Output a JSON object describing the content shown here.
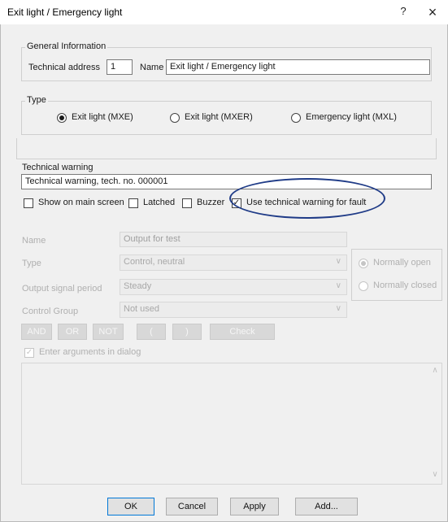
{
  "window": {
    "title": "Exit light / Emergency light",
    "help": "?",
    "close": "×"
  },
  "general": {
    "legend": "General Information",
    "tech_address_label": "Technical address",
    "tech_address_value": "1",
    "name_label": "Name",
    "name_value": "Exit light / Emergency light"
  },
  "type": {
    "legend": "Type",
    "options": [
      {
        "label": "Exit light (MXE)",
        "selected": true
      },
      {
        "label": "Exit light (MXER)",
        "selected": false
      },
      {
        "label": "Emergency light (MXL)",
        "selected": false
      }
    ]
  },
  "warning": {
    "legend": "Technical warning",
    "value": "Technical warning, tech. no. 000001",
    "checkboxes": [
      {
        "label": "Show on main screen",
        "checked": false
      },
      {
        "label": "Latched",
        "checked": false
      },
      {
        "label": "Buzzer",
        "checked": false
      },
      {
        "label": "Use technical warning for fault",
        "checked": true
      }
    ]
  },
  "output": {
    "name_label": "Name",
    "name_value": "Output for test",
    "type_label": "Type",
    "type_value": "Control, neutral",
    "period_label": "Output signal period",
    "period_value": "Steady",
    "group_label": "Control Group",
    "group_value": "Not used",
    "normally_open": "Normally open",
    "normally_closed": "Normally closed",
    "logic_buttons": [
      "AND",
      "OR",
      "NOT",
      "(",
      ")",
      "Check"
    ],
    "enter_args": "Enter arguments in dialog"
  },
  "buttons": {
    "ok": "OK",
    "cancel": "Cancel",
    "apply": "Apply",
    "add": "Add..."
  }
}
